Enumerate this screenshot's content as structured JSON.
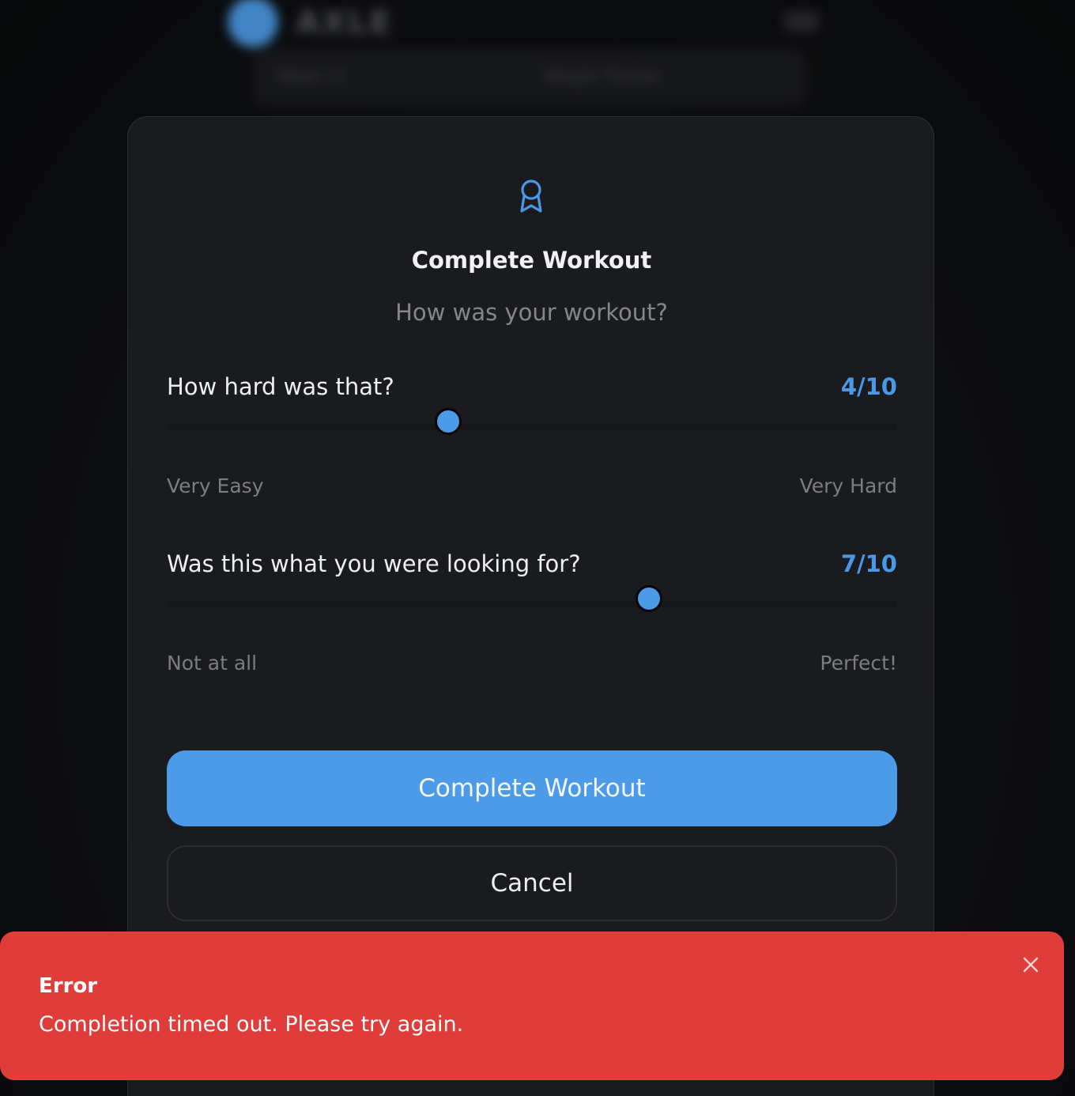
{
  "background": {
    "brand": "AXLE",
    "tabs": [
      "Week 12",
      "Weight Tracker"
    ]
  },
  "modal": {
    "icon": "award-icon",
    "title": "Complete Workout",
    "subtitle": "How was your workout?",
    "sliders": [
      {
        "question": "How hard was that?",
        "value": 4,
        "max": 10,
        "display": "4/10",
        "min_label": "Very Easy",
        "max_label": "Very Hard"
      },
      {
        "question": "Was this what you were looking for?",
        "value": 7,
        "max": 10,
        "display": "7/10",
        "min_label": "Not at all",
        "max_label": "Perfect!"
      }
    ],
    "primary_button": "Complete Workout",
    "secondary_button": "Cancel"
  },
  "toast": {
    "title": "Error",
    "message": "Completion timed out. Please try again.",
    "close_icon": "close-icon"
  },
  "colors": {
    "accent": "#4c9be8",
    "modal_bg": "#1a1b1f",
    "error": "#e03c3a"
  }
}
